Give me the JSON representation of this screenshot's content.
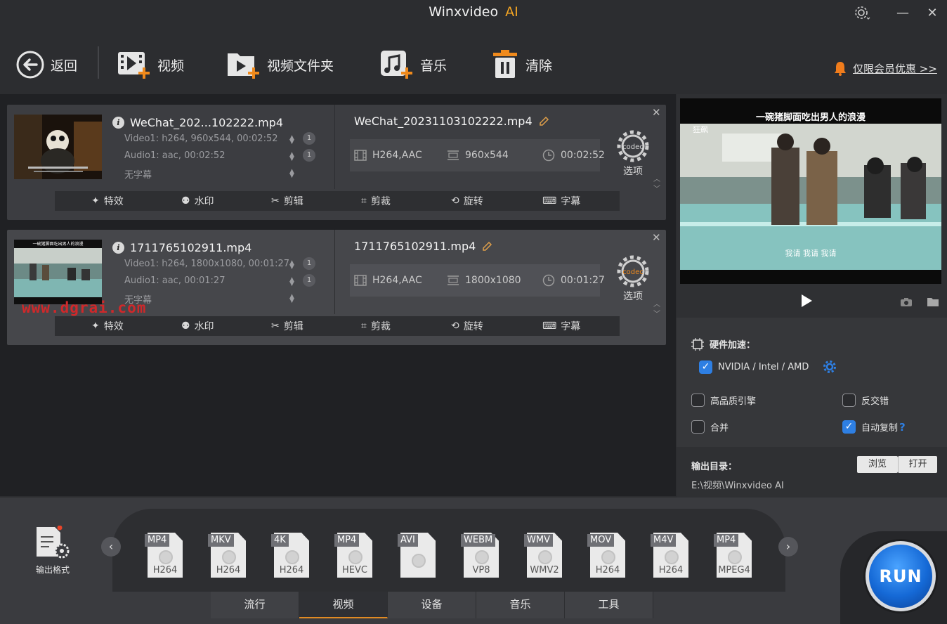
{
  "app": {
    "title": "Winxvideo",
    "title_accent": "AI",
    "accent_color": "#f5a623"
  },
  "toolbar": {
    "back": "返回",
    "video": "视频",
    "video_folder": "视频文件夹",
    "music": "音乐",
    "clear": "清除",
    "promo": "仅限会员优惠 >>"
  },
  "files": [
    {
      "name": "WeChat_202...102222.mp4",
      "video_info": "Video1: h264, 960x544, 00:02:52",
      "audio_info": "Audio1: aac, 00:02:52",
      "subtitle": "无字幕",
      "video_track": "1",
      "audio_track": "1",
      "output_name": "WeChat_20231103102222.mp4",
      "out_codec": "H264,AAC",
      "out_res": "960x544",
      "out_dur": "00:02:52",
      "codec_icon": "codec",
      "options": "选项"
    },
    {
      "name": "1711765102911.mp4",
      "video_info": "Video1: h264, 1800x1080, 00:01:27",
      "audio_info": "Audio1: aac, 00:01:27",
      "subtitle": "无字幕",
      "video_track": "1",
      "audio_track": "1",
      "output_name": "1711765102911.mp4",
      "out_codec": "H264,AAC",
      "out_res": "1800x1080",
      "out_dur": "00:01:27",
      "codec_icon": "codec",
      "options": "选项"
    }
  ],
  "editbar": {
    "effects": "特效",
    "watermark": "水印",
    "cut": "剪辑",
    "crop": "剪裁",
    "rotate": "旋转",
    "subtitle": "字幕"
  },
  "thumb_captions": {
    "file2_top": "一碗猪脚面吃出男人的浪漫"
  },
  "watermark_text": "www.dgrai.com",
  "preview": {
    "caption_top": "一碗猪脚面吃出男人的浪漫",
    "caption_corner": "狂飙",
    "caption_bottom": "我请 我请 我请"
  },
  "settings": {
    "hw_accel": "硬件加速：",
    "gpu": "NVIDIA / Intel / AMD",
    "gpu_checked": true,
    "hq_engine": "高品质引擎",
    "deinterlace": "反交错",
    "merge": "合并",
    "auto_copy": "自动复制",
    "auto_copy_checked": true,
    "help": "?"
  },
  "output": {
    "label": "输出目录：",
    "browse": "浏览",
    "open": "打开",
    "path": "E:\\视频\\Winxvideo AI"
  },
  "formats_label": "输出格式",
  "formats": [
    {
      "tag": "MP4",
      "codec": "H264"
    },
    {
      "tag": "MKV",
      "codec": "H264"
    },
    {
      "tag": "4K",
      "codec": "H264"
    },
    {
      "tag": "MP4",
      "codec": "HEVC"
    },
    {
      "tag": "AVI",
      "codec": ""
    },
    {
      "tag": "WEBM",
      "codec": "VP8"
    },
    {
      "tag": "WMV",
      "codec": "WMV2"
    },
    {
      "tag": "MOV",
      "codec": "H264"
    },
    {
      "tag": "M4V",
      "codec": "H264"
    },
    {
      "tag": "MP4",
      "codec": "MPEG4"
    }
  ],
  "tabs": [
    "流行",
    "视频",
    "设备",
    "音乐",
    "工具"
  ],
  "active_tab": "视频",
  "run": "RUN"
}
